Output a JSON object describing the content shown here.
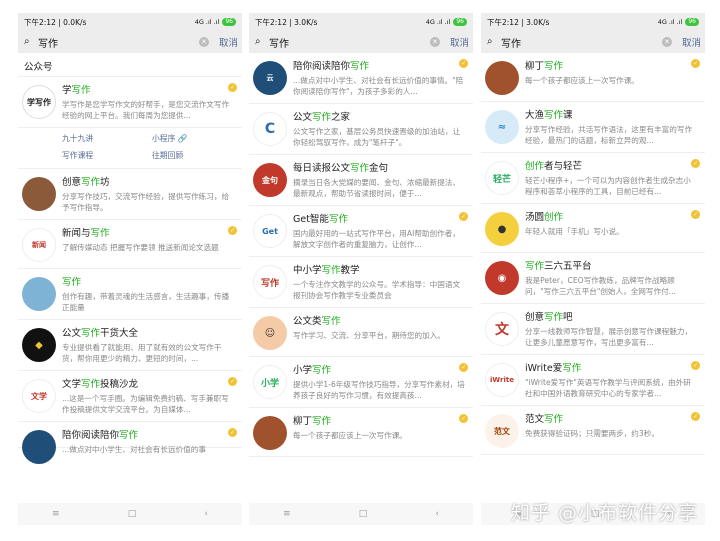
{
  "status": {
    "p1_time": "下午2:12 | 0.0K/s",
    "p2_time": "下午2:12 | 3.0K/s",
    "p3_time": "下午2:12 | 3.0K/s",
    "battery": "96",
    "signal": "4G .ıl .ıl"
  },
  "search": {
    "query": "写作",
    "cancel": "取消"
  },
  "panel1": {
    "section_title": "公众号",
    "items": [
      {
        "name_parts": [
          "学",
          "写作"
        ],
        "desc": "学写作是您学写作文的好帮手，是您交流作文写作经验的网上平台。我们每周为您提供...",
        "verified": true
      },
      {
        "name_parts": [
          "创意",
          "写作",
          "坊"
        ],
        "desc": "分享写作技巧，交流写作经验，提供写作练习，给予写作指导。",
        "verified": false
      },
      {
        "name_parts": [
          "新闻与",
          "写作"
        ],
        "desc": "了解传媒动态 把握写作要领 推送新闻论文选题",
        "verified": true
      },
      {
        "name_parts": [
          "写作"
        ],
        "desc": "创作有趣，带着灵魂的生活感言，生活趣事，传播正能量",
        "verified": false
      },
      {
        "name_parts": [
          "公文",
          "写作",
          "干货大全"
        ],
        "desc": "专业提供看了就能用、用了就有效的公文写作干货，帮你用更少的精力、更短的时间，...",
        "verified": false
      },
      {
        "name_parts": [
          "文学",
          "写作",
          "投稿沙龙"
        ],
        "desc": "...这是一个写手圈。为编辑免费约稿、写手兼职写作投稿提供文学交流平台。为自媒体...",
        "verified": true
      },
      {
        "name_parts": [
          "陪你阅读陪你",
          "写作"
        ],
        "desc": "...做点对中小学生、对社会有长远价值的事",
        "verified": true
      }
    ],
    "menu": [
      "九十九讲",
      "小程序 🔗",
      "写作课程",
      "往期回顾"
    ]
  },
  "panel2": {
    "items": [
      {
        "name_parts": [
          "陪你阅读陪你",
          "写作"
        ],
        "desc": "...做点对中小学生、对社会有长远价值的事情。\"陪你阅读陪你写作\"，为孩子多彩的人...",
        "verified": true
      },
      {
        "name_parts": [
          "公文",
          "写作",
          "之家"
        ],
        "desc": "公文写作之家，基层公务员快速晋级的加油站，让你轻松驾驭写作，成为\"笔杆子\"。",
        "verified": false
      },
      {
        "name_parts": [
          "每日读报公文",
          "写作",
          "金句"
        ],
        "desc": "摘录当日各大党媒的要闻、金句、浓缩最新提法、最新观点，帮助节省读报时间，便于...",
        "verified": false
      },
      {
        "name_parts": [
          "Get智能",
          "写作"
        ],
        "desc": "国内最好用的一站式写作平台，用AI帮助创作者，解放文字创作者的重复脑力，让创作...",
        "verified": true
      },
      {
        "name_parts": [
          "中小学",
          "写作",
          "教学"
        ],
        "desc": "一个专注作文教学的公众号。学术指导：中国语文报刊协会写作教学专业委员会",
        "verified": false
      },
      {
        "name_parts": [
          "公文类",
          "写作"
        ],
        "desc": "写作学习、交流、分享平台，期待您的加入。",
        "verified": false
      },
      {
        "name_parts": [
          "小学",
          "写作"
        ],
        "desc": "提供小学1-6年级写作技巧指导，分享写作素材，培养孩子良好的写作习惯，有效提高孩...",
        "verified": true
      },
      {
        "name_parts": [
          "柳丁",
          "写作"
        ],
        "desc": "每一个孩子都应该上一次写作课。",
        "verified": true
      }
    ]
  },
  "panel3": {
    "items": [
      {
        "name_parts": [
          "柳丁",
          "写作"
        ],
        "desc": "每一个孩子都应该上一次写作课。",
        "verified": true
      },
      {
        "name_parts": [
          "大渔",
          "写作",
          "课"
        ],
        "desc": "分享写作经验，共活写作语法，这里有丰富的写作经验，最热门的话题，标新立异的观...",
        "verified": false
      },
      {
        "name_parts": [
          "创作",
          "者与轻芒"
        ],
        "desc": "轻芒小程序+，一个可以为内容创作者生成杂志小程序和荟萃小程序的工具，目前已经有...",
        "verified": true
      },
      {
        "name_parts": [
          "汤圆",
          "创作"
        ],
        "desc": "年轻人就用「手机」写小说。",
        "verified": true
      },
      {
        "name_parts": [
          "写作",
          "三六五平台"
        ],
        "desc": "我是Peter，CEO写作教练，品牌写作战略顾问，\"写作三六五平台\"创始人，全网写作付...",
        "verified": false
      },
      {
        "name_parts": [
          "创意",
          "写作",
          "吧"
        ],
        "desc": "分享一线教师写作智慧，展示创意写作课程魅力，让更多儿童愿意写作，写出更多富有...",
        "verified": false
      },
      {
        "name_parts": [
          "iWrite爱",
          "写作"
        ],
        "desc": "\"iWrite爱写作\"英语写作教学与评阅系统，由外研社和中国外语教育研究中心的专家学者...",
        "verified": true
      },
      {
        "name_parts": [
          "范文",
          "写作"
        ],
        "desc": "免费获得验证码；只需要两步，约3秒。",
        "verified": true
      }
    ]
  },
  "nav": {
    "menu": "≡",
    "home": "□",
    "back": "‹"
  },
  "watermark": "知乎 @小布软件分享",
  "colors": {
    "highlight": "#1aad19",
    "link": "#576b95",
    "verified": "#f1c232"
  }
}
